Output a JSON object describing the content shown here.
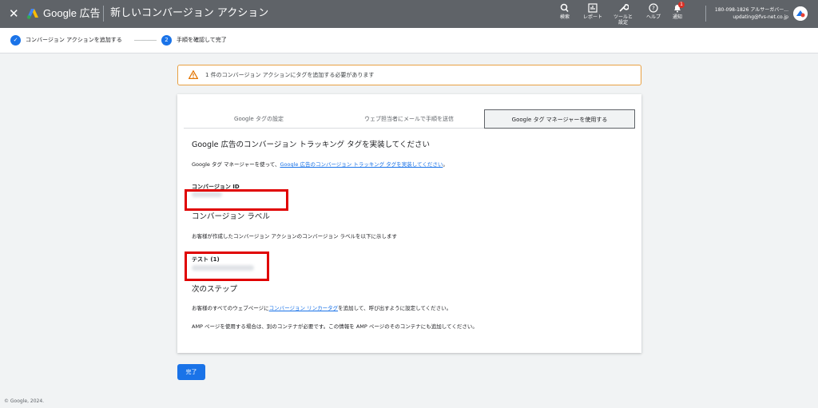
{
  "header": {
    "brand": "Google 広告",
    "title": "新しいコンバージョン アクション",
    "tools": [
      {
        "icon": "search-icon",
        "label": "検索"
      },
      {
        "icon": "reports-icon",
        "label": "レポート"
      },
      {
        "icon": "tools-icon",
        "label": "ツールと設定"
      },
      {
        "icon": "help-icon",
        "label": "ヘルプ"
      },
      {
        "icon": "bell-icon",
        "label": "通知"
      }
    ],
    "notification_count": "1",
    "account_line1": "180-098-1826 アルサーガバー...",
    "account_line2": "updating@fvs-net.co.jp"
  },
  "stepper": {
    "step1_label": "コンバージョン アクションを追加する",
    "step2_number": "2",
    "step2_label": "手順を確認して完了"
  },
  "warning": {
    "text": "1 件のコンバージョン アクションにタグを追加する必要があります"
  },
  "tabs": [
    "Google タグの設定",
    "ウェブ担当者にメールで手順を送信",
    "Google タグ マネージャーを使用する"
  ],
  "content": {
    "heading": "Google 広告のコンバージョン トラッキング タグを実装してください",
    "intro_prefix": "Google タグ マネージャーを使って、",
    "intro_link": "Google 広告のコンバージョン トラッキング タグを実装してください",
    "intro_suffix": "。",
    "conversion_id_label": "コンバージョン ID",
    "conversion_label_heading": "コンバージョン ラベル",
    "conversion_label_desc": "お客様が作成したコンバージョン アクションのコンバージョン ラベルを以下に示します",
    "test_label": "テスト (1)",
    "next_steps_heading": "次のステップ",
    "next_steps_prefix": "お客様のすべてのウェブページに",
    "next_steps_link": "コンバージョン リンカータグ",
    "next_steps_suffix": "を追加して、呼び出すように設定してください。",
    "amp_note": "AMP ページを使用する場合は、別のコンテナが必要です。この情報を AMP ページのそのコンテナにも追加してください。"
  },
  "done_button": "完了",
  "footer": "© Google, 2024.",
  "colors": {
    "accent": "#1a73e8",
    "warning_border": "#e8a042",
    "highlight_box": "#e00000",
    "header_bg": "#5f6368"
  }
}
